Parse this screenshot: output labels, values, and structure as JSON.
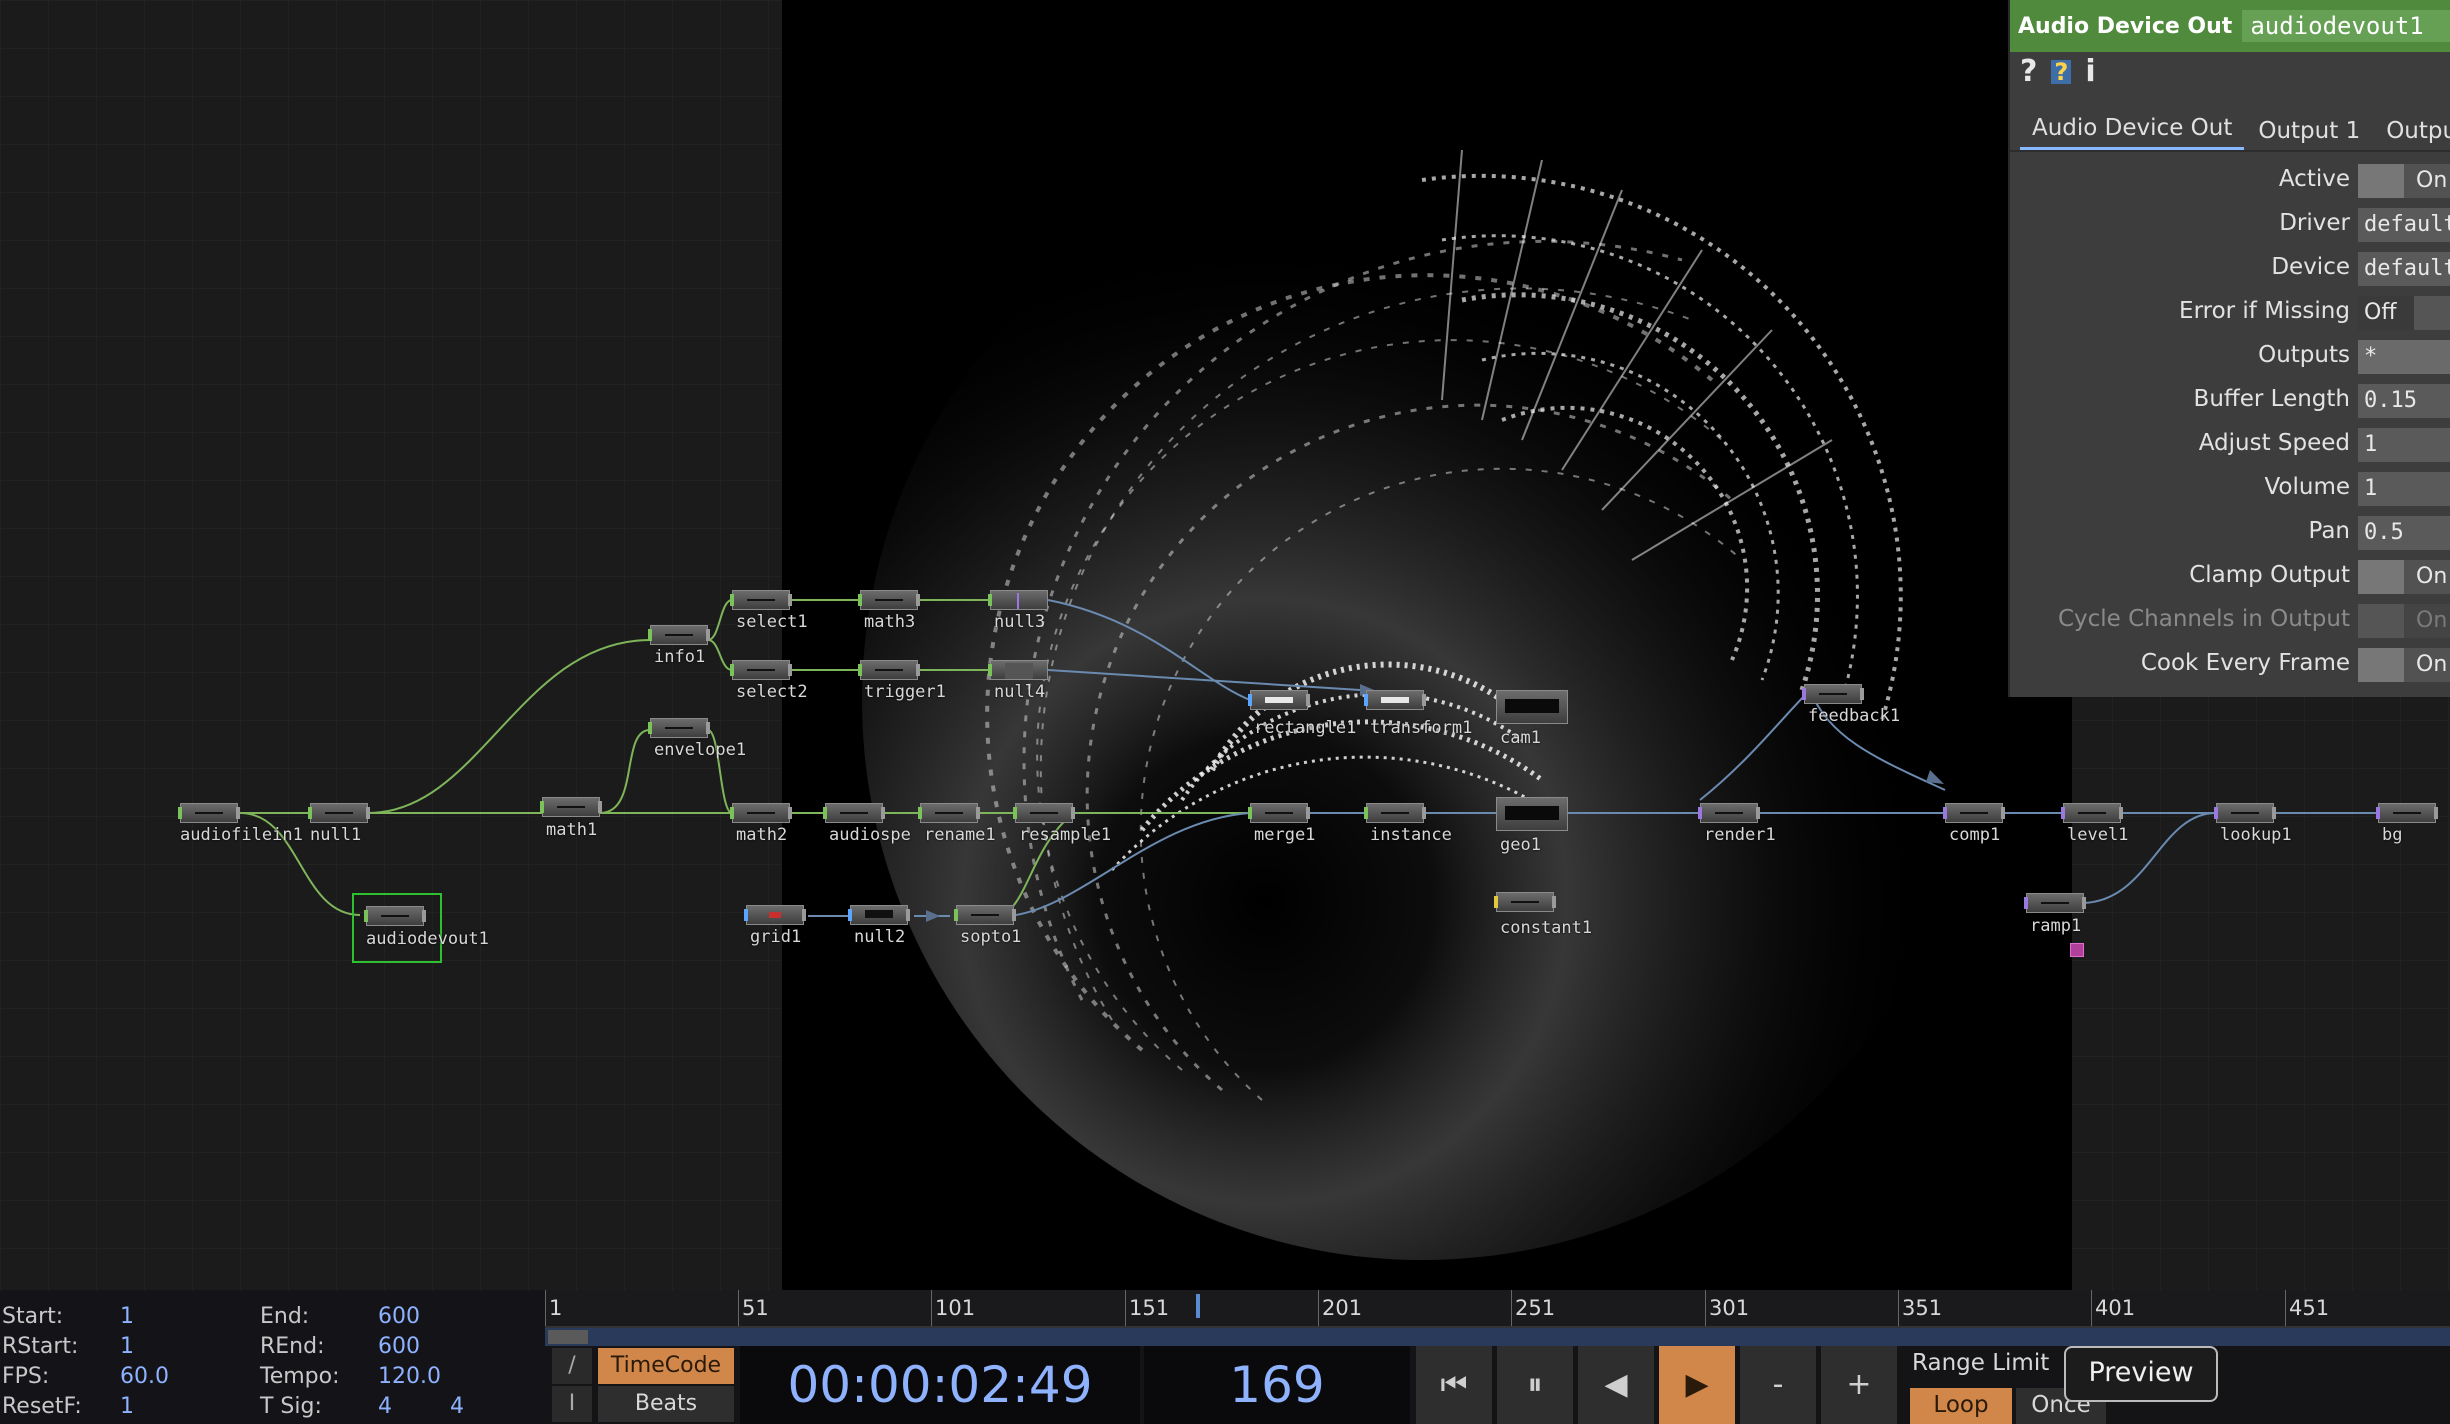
{
  "network": {
    "nodes": [
      {
        "id": "audiofilein1",
        "label": "audiofilein1",
        "color": "green"
      },
      {
        "id": "null1",
        "label": "null1",
        "color": "green"
      },
      {
        "id": "audiodevout1",
        "label": "audiodevout1",
        "color": "green"
      },
      {
        "id": "math1",
        "label": "math1",
        "color": "green"
      },
      {
        "id": "info1",
        "label": "info1",
        "color": "green"
      },
      {
        "id": "envelope1",
        "label": "envelope1",
        "color": "green"
      },
      {
        "id": "select1",
        "label": "select1",
        "color": "green"
      },
      {
        "id": "select2",
        "label": "select2",
        "color": "green"
      },
      {
        "id": "math3",
        "label": "math3",
        "color": "green"
      },
      {
        "id": "trigger1",
        "label": "trigger1",
        "color": "green"
      },
      {
        "id": "null3",
        "label": "null3",
        "color": "green"
      },
      {
        "id": "null4",
        "label": "null4",
        "color": "green"
      },
      {
        "id": "math2",
        "label": "math2",
        "color": "green"
      },
      {
        "id": "audiospectrum1",
        "label": "audiospe",
        "color": "green"
      },
      {
        "id": "rename1",
        "label": "rename1",
        "color": "green"
      },
      {
        "id": "resample1",
        "label": "resample1",
        "color": "green"
      },
      {
        "id": "grid1",
        "label": "grid1",
        "color": "blue"
      },
      {
        "id": "null2",
        "label": "null2",
        "color": "blue"
      },
      {
        "id": "sopto1",
        "label": "sopto1",
        "color": "green"
      },
      {
        "id": "rectangle1",
        "label": "rectangle1",
        "color": "blue"
      },
      {
        "id": "transform1",
        "label": "transform1",
        "color": "blue"
      },
      {
        "id": "merge1",
        "label": "merge1",
        "color": "green"
      },
      {
        "id": "instance",
        "label": "instance",
        "color": "green"
      },
      {
        "id": "cam1",
        "label": "cam1",
        "color": "gray"
      },
      {
        "id": "geo1",
        "label": "geo1",
        "color": "gray"
      },
      {
        "id": "constant1",
        "label": "constant1",
        "color": "yellow"
      },
      {
        "id": "feedback1",
        "label": "feedback1",
        "color": "purple"
      },
      {
        "id": "render1",
        "label": "render1",
        "color": "purple"
      },
      {
        "id": "comp1",
        "label": "comp1",
        "color": "purple"
      },
      {
        "id": "level1",
        "label": "level1",
        "color": "purple"
      },
      {
        "id": "lookup1",
        "label": "lookup1",
        "color": "purple"
      },
      {
        "id": "bg",
        "label": "bg",
        "color": "purple"
      },
      {
        "id": "ramp1",
        "label": "ramp1",
        "color": "purple"
      }
    ]
  },
  "panel": {
    "type_label": "Audio Device Out",
    "node_name": "audiodevout1",
    "icons": [
      "help-icon",
      "python-help-icon",
      "info-icon"
    ],
    "tabs": [
      "Audio Device Out",
      "Output 1",
      "Outpu"
    ],
    "params": [
      {
        "label": "Active",
        "kind": "toggle",
        "value": "On"
      },
      {
        "label": "Driver",
        "kind": "menu",
        "value": "default"
      },
      {
        "label": "Device",
        "kind": "menu",
        "value": "default"
      },
      {
        "label": "Error if Missing",
        "kind": "offtoggle",
        "value": "Off"
      },
      {
        "label": "Outputs",
        "kind": "text",
        "value": "*"
      },
      {
        "label": "Buffer Length",
        "kind": "number",
        "value": "0.15"
      },
      {
        "label": "Adjust Speed",
        "kind": "number",
        "value": "1"
      },
      {
        "label": "Volume",
        "kind": "number",
        "value": "1"
      },
      {
        "label": "Pan",
        "kind": "number",
        "value": "0.5"
      },
      {
        "label": "Clamp Output",
        "kind": "toggle",
        "value": "On"
      },
      {
        "label": "Cycle Channels in Output",
        "kind": "toggle",
        "value": "On",
        "disabled": true
      },
      {
        "label": "Cook Every Frame",
        "kind": "toggle",
        "value": "On"
      }
    ]
  },
  "timeline": {
    "stats": {
      "start_label": "Start:",
      "start": "1",
      "end_label": "End:",
      "end": "600",
      "rstart_label": "RStart:",
      "rstart": "1",
      "rend_label": "REnd:",
      "rend": "600",
      "fps_label": "FPS:",
      "fps": "60.0",
      "tempo_label": "Tempo:",
      "tempo": "120.0",
      "resetf_label": "ResetF:",
      "resetf": "1",
      "tsig_label": "T Sig:",
      "tsig_a": "4",
      "tsig_b": "4"
    },
    "ruler_ticks": [
      "1",
      "51",
      "101",
      "151",
      "201",
      "251",
      "301",
      "351",
      "401",
      "451"
    ],
    "slash_label": "/",
    "i_label": "I",
    "timecode_label": "TimeCode",
    "beats_label": "Beats",
    "timecode": "00:00:02:49",
    "frame": "169",
    "transport": {
      "rewind": "⏮",
      "pause": "⏸",
      "step_back": "◀",
      "play": "▶",
      "minus": "-",
      "plus": "+"
    },
    "range_limit_label": "Range Limit",
    "loop_label": "Loop",
    "once_label": "Once",
    "tooltip": "Preview"
  },
  "colors": {
    "accent": "#4f8a3d",
    "play_active": "#d2874a",
    "value_blue": "#8fb2ff",
    "selection": "#2fc02f"
  }
}
